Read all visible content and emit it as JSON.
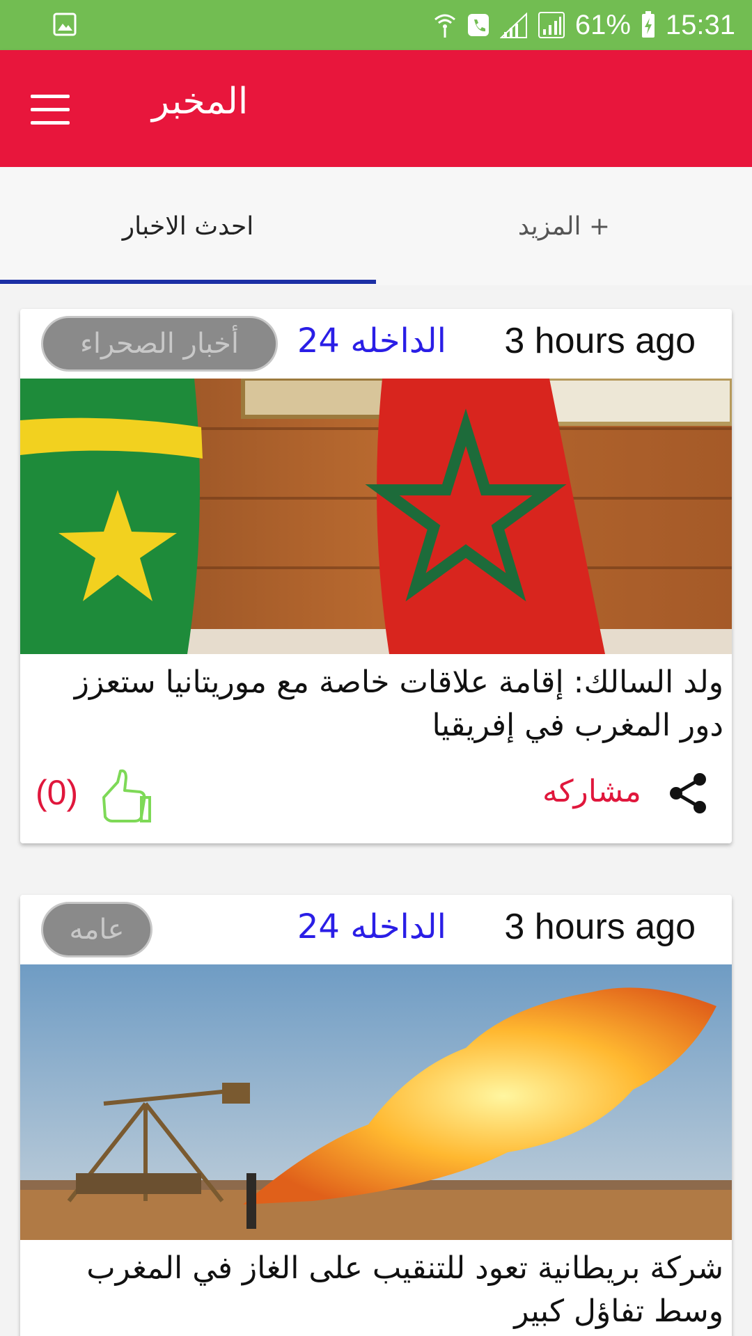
{
  "status_bar": {
    "battery": "61%",
    "time": "15:31"
  },
  "app_bar": {
    "title": "المخبر",
    "menu_icon": "hamburger-icon"
  },
  "tabs": [
    {
      "label": "احدث الاخبار",
      "selected": true
    },
    {
      "label": "المزيد +",
      "selected": false
    }
  ],
  "colors": {
    "status_bar": "#72bd52",
    "app_bar": "#e8163c",
    "indicator": "#1c2fa5",
    "source": "#2a1ee6",
    "accent_red": "#e0173c"
  },
  "articles": [
    {
      "time_ago": "3 hours ago",
      "source": "الداخله 24",
      "category": "أخبار الصحراء",
      "headline": "ولد السالك: إقامة علاقات خاصة مع موريتانيا ستعزز دور المغرب في إفريقيا",
      "share_label": "مشاركه",
      "likes": "(0)"
    },
    {
      "time_ago": "3 hours ago",
      "source": "الداخله 24",
      "category": "عامه",
      "headline": "شركة بريطانية تعود للتنقيب على الغاز في المغرب وسط تفاؤل كبير"
    }
  ]
}
